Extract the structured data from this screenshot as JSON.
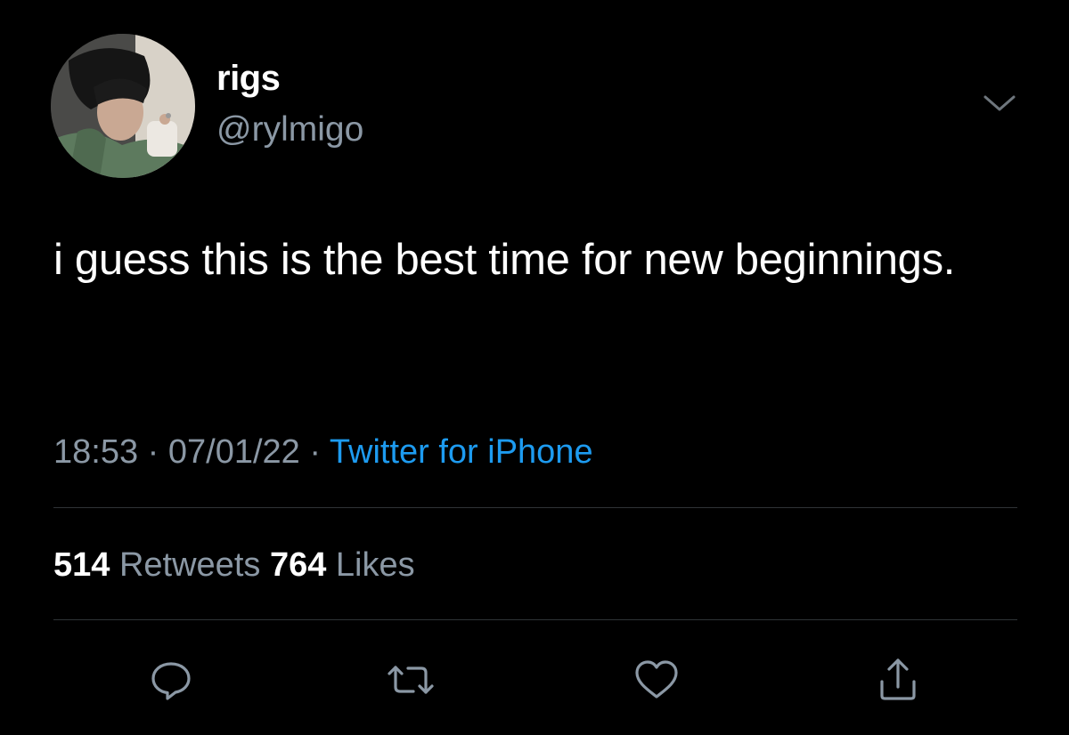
{
  "user": {
    "display_name": "rigs",
    "handle": "@rylmigo",
    "avatar_icon": "profile-photo"
  },
  "tweet": {
    "text": "i guess this is the best time for new beginnings.",
    "time": "18:53",
    "date": "07/01/22",
    "separator": "·",
    "source": "Twitter for iPhone"
  },
  "stats": {
    "retweets_count": "514",
    "retweets_label": "Retweets",
    "likes_count": "764",
    "likes_label": "Likes"
  },
  "actions": {
    "reply_icon": "reply-icon",
    "retweet_icon": "retweet-icon",
    "like_icon": "heart-icon",
    "share_icon": "share-icon"
  },
  "colors": {
    "background": "#000000",
    "text_primary": "#ffffff",
    "text_secondary": "#8b98a5",
    "link": "#1d9bf0",
    "divider": "#2f3336"
  }
}
